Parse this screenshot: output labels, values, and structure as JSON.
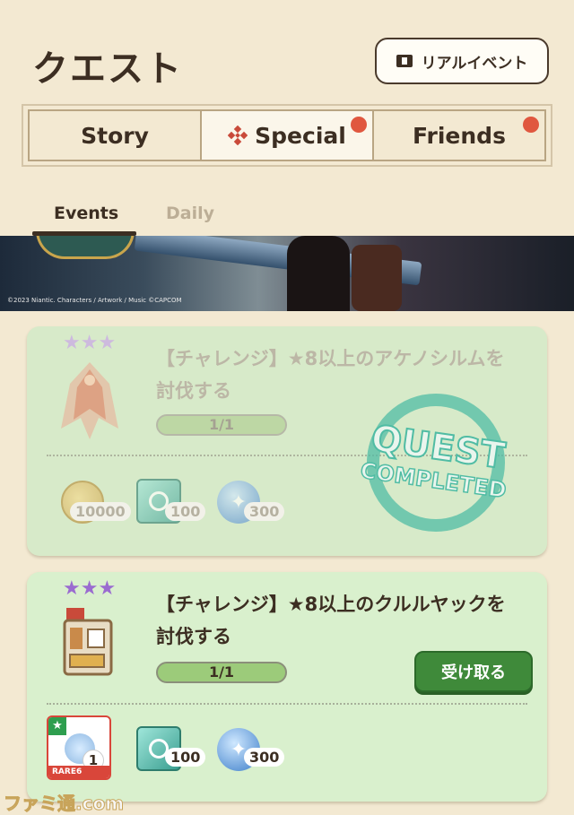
{
  "header": {
    "title": "クエスト",
    "real_event_label": "リアルイベント"
  },
  "tabs": [
    {
      "label": "Story",
      "active": false,
      "badge": false
    },
    {
      "label": "Special",
      "active": true,
      "badge": true
    },
    {
      "label": "Friends",
      "active": false,
      "badge": true
    }
  ],
  "subtabs": [
    {
      "label": "Events",
      "active": true
    },
    {
      "label": "Daily",
      "active": false
    }
  ],
  "banner": {
    "copyright": "©2023 Niantic. Characters / Artwork / Music ©CAPCOM"
  },
  "quests": [
    {
      "title": "【チャレンジ】★8以上のアケノシルムを討伐する",
      "stars": 3,
      "progress_text": "1/1",
      "progress": 1,
      "status_stamp": [
        "QUEST",
        "COMPLETED"
      ],
      "rewards": [
        {
          "icon": "zenny-coin-icon",
          "count": "10000"
        },
        {
          "icon": "gem-icon",
          "count": "100"
        },
        {
          "icon": "orb-icon",
          "count": "300"
        }
      ]
    },
    {
      "title": "【チャレンジ】★8以上のクルルヤックを討伐する",
      "stars": 3,
      "progress_text": "1/1",
      "progress": 1,
      "receive_label": "受け取る",
      "rewards": [
        {
          "icon": "rare-material-icon",
          "count": "1",
          "rarity": "RARE6"
        },
        {
          "icon": "gem-icon",
          "count": "100"
        },
        {
          "icon": "orb-icon",
          "count": "300"
        }
      ]
    }
  ],
  "watermark": "ファミ通.com",
  "colors": {
    "background": "#f3e9d2",
    "card": "#d5ebc9",
    "accent_green": "#3f8a3a",
    "badge_red": "#e0573f"
  }
}
